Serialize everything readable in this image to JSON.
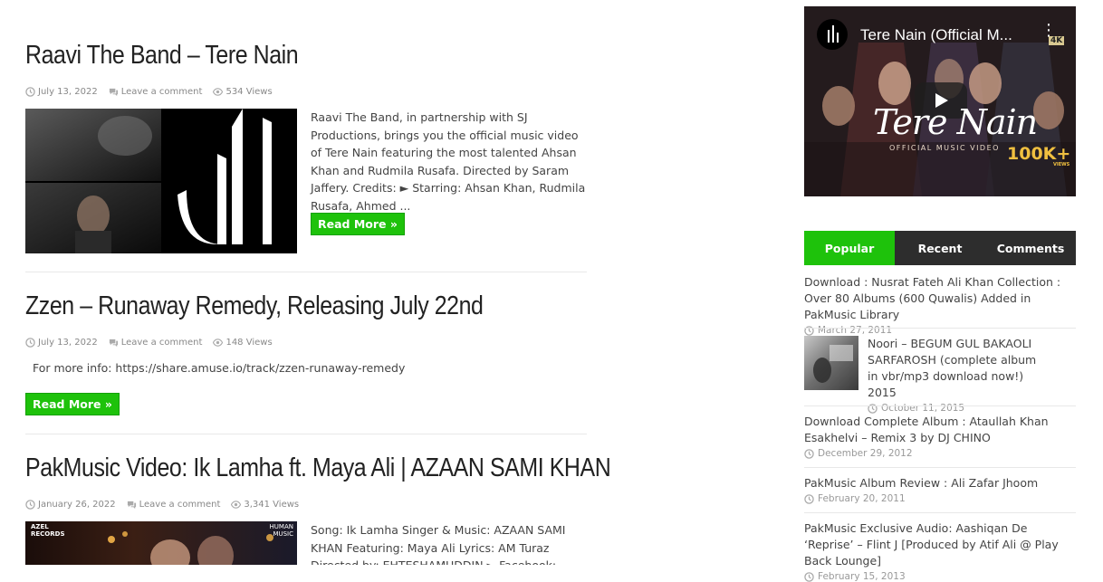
{
  "posts": [
    {
      "title": "Raavi The Band – Tere Nain",
      "date": "July 13, 2022",
      "comment": "Leave a comment",
      "views": "534 Views",
      "excerpt": "  Raavi The Band, in partnership with SJ Productions, brings you the official music video of Tere Nain featuring the most talented Ahsan Khan and Rudmila Rusafa. Directed by Saram Jaffery.    Credits: ► Starring: Ahsan Khan, Rudmila Rusafa, Ahmed ...",
      "read_more": "Read More »"
    },
    {
      "title": "Zzen – Runaway Remedy, Releasing July 22nd",
      "date": "July 13, 2022",
      "comment": "Leave a comment",
      "views": "148 Views",
      "excerpt": "  For more info: https://share.amuse.io/track/zzen-runaway-remedy",
      "read_more": "Read More »"
    },
    {
      "title": "PakMusic Video: Ik Lamha ft. Maya Ali | AZAAN SAMI KHAN",
      "date": "January 26, 2022",
      "comment": "Leave a comment",
      "views": "3,341 Views",
      "excerpt": "Song: Ik Lamha Singer & Music: AZAAN SAMI KHAN Featuring: Maya Ali Lyrics: AM Turaz Directed by: EHTESHAMUDDIN ► Facebook: PAKMUSIC ►",
      "thumb_label_left": "AZEL RECORDS",
      "thumb_label_right": "HUMAN MUSIC"
    }
  ],
  "video": {
    "title": "Tere Nain (Official M...",
    "script_title": "Tere Nain",
    "subtitle": "OFFICIAL MUSIC VIDEO",
    "views_badge": "100K+",
    "views_small": "VIEWS",
    "quality": "4K"
  },
  "tabs": [
    "Popular",
    "Recent",
    "Comments"
  ],
  "popular": [
    {
      "title": "Download : Nusrat Fateh Ali Khan Collection : Over 80 Albums (600 Quwalis) Added in PakMusic Library",
      "date": "March 27, 2011"
    },
    {
      "title": "Noori – BEGUM GUL BAKAOLI SARFAROSH (complete album in vbr/mp3 download now!) 2015",
      "date": "October 11, 2015"
    },
    {
      "title": "Download Complete Album : Ataullah Khan Esakhelvi – Remix 3 by DJ CHINO",
      "date": "December 29, 2012"
    },
    {
      "title": "PakMusic Album Review : Ali Zafar Jhoom",
      "date": "February 20, 2011"
    },
    {
      "title": "PakMusic Exclusive Audio: Aashiqan De ‘Reprise’ – Flint J [Produced by Atif Ali @ Play Back Lounge]",
      "date": "February 15, 2013"
    }
  ]
}
